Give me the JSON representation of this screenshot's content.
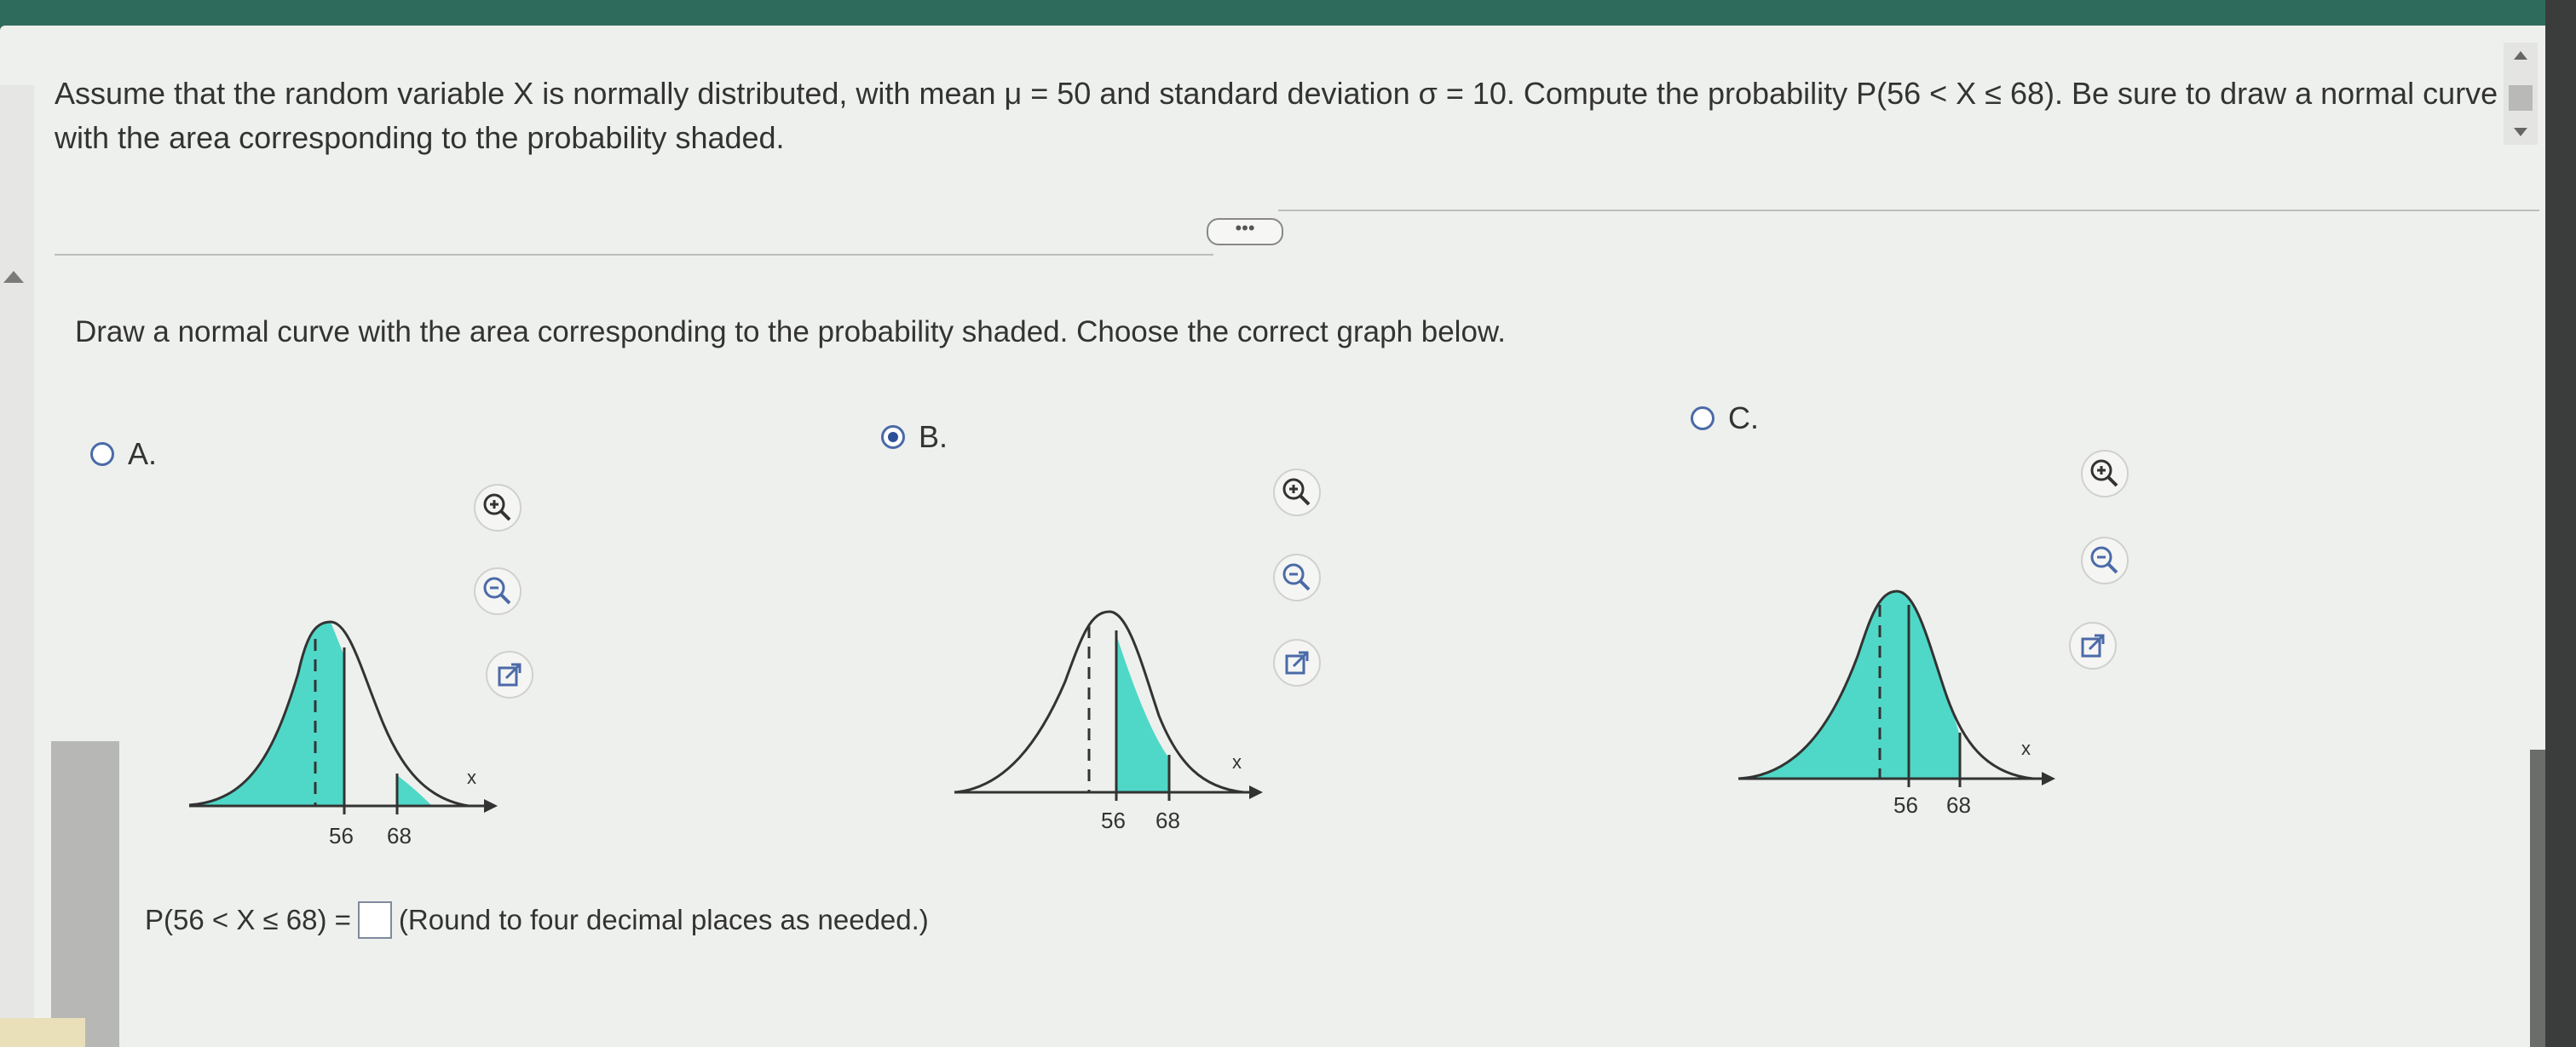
{
  "question": {
    "text": "Assume that the random variable X is normally distributed, with mean μ = 50 and standard deviation σ = 10. Compute the probability P(56 < X ≤ 68). Be sure to draw a normal curve with the area corresponding to the probability shaded."
  },
  "more_button": {
    "label": "•••"
  },
  "instruction": "Draw a normal curve with the area corresponding to the probability shaded. Choose the correct graph below.",
  "options": [
    {
      "label": "A.",
      "selected": false,
      "tick_left": "56",
      "tick_right": "68",
      "axis_label": "x"
    },
    {
      "label": "B.",
      "selected": true,
      "tick_left": "56",
      "tick_right": "68",
      "axis_label": "x"
    },
    {
      "label": "C.",
      "selected": false,
      "tick_left": "56",
      "tick_right": "68",
      "axis_label": "x"
    }
  ],
  "icons": [
    "zoom-in-icon",
    "zoom-out-icon",
    "open-external-icon"
  ],
  "answer": {
    "prefix": "P(56 < X ≤ 68) =",
    "value": "",
    "hint": "(Round to four decimal places as needed.)"
  },
  "colors": {
    "shade": "#4fd8c8",
    "radio_accent": "#2c4f9a",
    "header_bg": "#2f6b5c"
  }
}
